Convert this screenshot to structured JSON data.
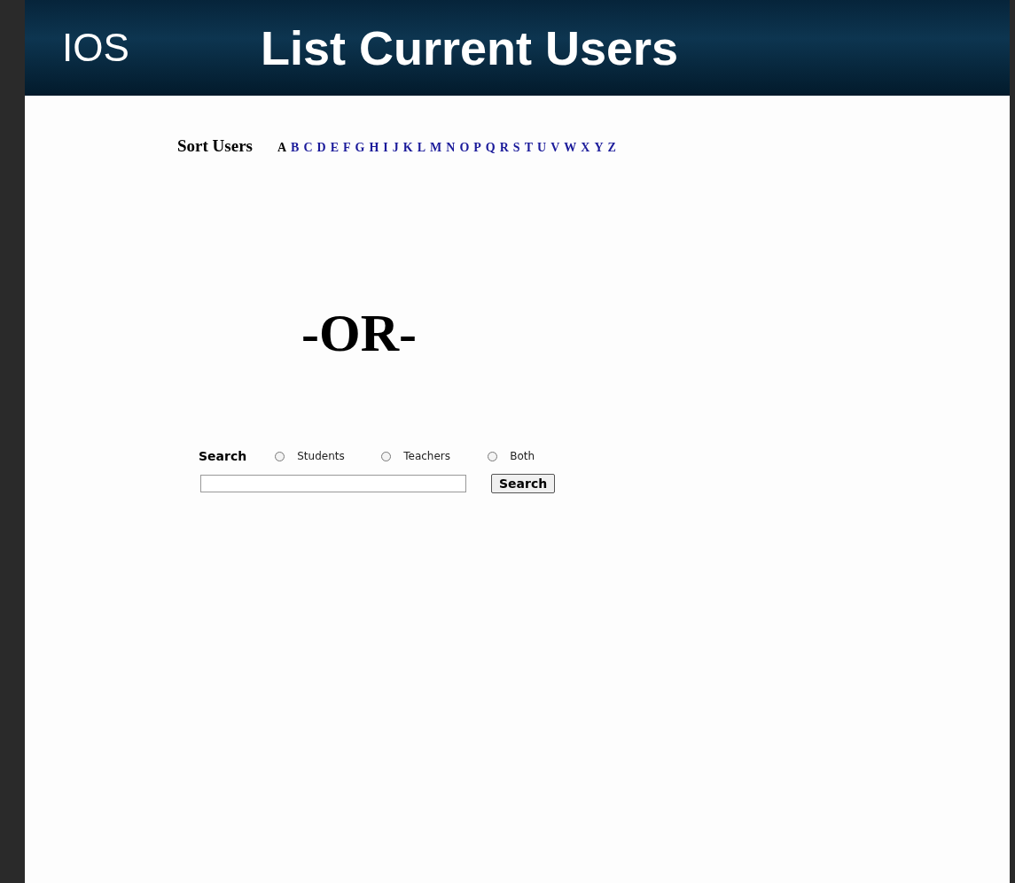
{
  "header": {
    "logo": "IOS",
    "title": "List Current Users"
  },
  "sort": {
    "label": "Sort Users",
    "letters": [
      {
        "label": "A",
        "selected": true
      },
      {
        "label": "B",
        "selected": false
      },
      {
        "label": "C",
        "selected": false
      },
      {
        "label": "D",
        "selected": false
      },
      {
        "label": "E",
        "selected": false
      },
      {
        "label": "F",
        "selected": false
      },
      {
        "label": "G",
        "selected": false
      },
      {
        "label": "H",
        "selected": false
      },
      {
        "label": "I",
        "selected": false
      },
      {
        "label": "J",
        "selected": false
      },
      {
        "label": "K",
        "selected": false
      },
      {
        "label": "L",
        "selected": false
      },
      {
        "label": "M",
        "selected": false
      },
      {
        "label": "N",
        "selected": false
      },
      {
        "label": "O",
        "selected": false
      },
      {
        "label": "P",
        "selected": false
      },
      {
        "label": "Q",
        "selected": false
      },
      {
        "label": "R",
        "selected": false
      },
      {
        "label": "S",
        "selected": false
      },
      {
        "label": "T",
        "selected": false
      },
      {
        "label": "U",
        "selected": false
      },
      {
        "label": "V",
        "selected": false
      },
      {
        "label": "W",
        "selected": false
      },
      {
        "label": "X",
        "selected": false
      },
      {
        "label": "Y",
        "selected": false
      },
      {
        "label": "Z",
        "selected": false
      }
    ]
  },
  "divider": "-OR-",
  "search": {
    "label": "Search",
    "options": [
      {
        "label": "Students",
        "selected": false
      },
      {
        "label": "Teachers",
        "selected": false
      },
      {
        "label": "Both",
        "selected": false
      }
    ],
    "button": "Search"
  }
}
